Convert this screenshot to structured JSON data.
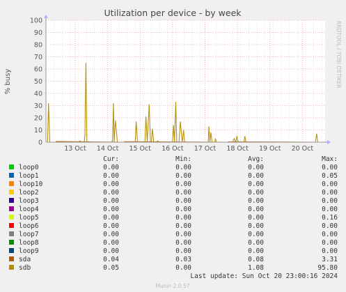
{
  "chart_data": {
    "type": "line",
    "title": "Utilization per device - by week",
    "ylabel": "% busy",
    "side_text": "RRDTOOL / TOBI OETIKER",
    "ylim": [
      0,
      100
    ],
    "yticks": [
      0,
      10,
      20,
      30,
      40,
      50,
      60,
      70,
      80,
      90,
      100
    ],
    "xlim_days": [
      0,
      8.6
    ],
    "xticks": [
      {
        "label": "13 Oct",
        "day": 0.9
      },
      {
        "label": "14 Oct",
        "day": 1.9
      },
      {
        "label": "15 Oct",
        "day": 2.9
      },
      {
        "label": "16 Oct",
        "day": 3.9
      },
      {
        "label": "17 Oct",
        "day": 4.9
      },
      {
        "label": "18 Oct",
        "day": 5.9
      },
      {
        "label": "19 Oct",
        "day": 6.9
      },
      {
        "label": "20 Oct",
        "day": 7.9
      }
    ],
    "series": [
      {
        "name": "sdb",
        "color": "#b8900a",
        "x": [
          0.0,
          0.05,
          0.08,
          0.12,
          0.2,
          1.0,
          1.05,
          1.08,
          1.11,
          1.18,
          1.2,
          1.23,
          1.26,
          1.3,
          2.0,
          2.05,
          2.08,
          2.1,
          2.14,
          2.2,
          2.75,
          2.78,
          2.82,
          2.86,
          3.05,
          3.08,
          3.12,
          3.18,
          3.22,
          3.25,
          3.28,
          3.32,
          3.37,
          3.4,
          3.44,
          3.5,
          3.85,
          3.9,
          3.93,
          3.96,
          4.0,
          4.03,
          4.06,
          4.1,
          4.14,
          4.2,
          4.24,
          4.27,
          4.3,
          4.33,
          4.38,
          4.45,
          4.95,
          5.0,
          5.02,
          5.05,
          5.08,
          5.12,
          5.2,
          5.22,
          5.25,
          5.3,
          5.75,
          5.8,
          5.85,
          5.88,
          5.92,
          6.1,
          6.13,
          6.16,
          6.2,
          8.3,
          8.34,
          8.37,
          8.4,
          8.5
        ],
        "values": [
          0,
          0,
          32,
          0,
          0,
          0,
          1,
          0,
          0,
          0,
          6,
          65,
          0,
          0,
          0,
          1,
          32,
          0,
          18,
          0,
          0,
          17,
          0,
          0,
          0,
          21,
          0,
          31,
          0,
          0,
          11,
          0,
          0,
          0,
          1,
          0,
          0,
          0,
          14,
          0,
          33,
          0,
          0,
          0,
          17,
          0,
          10,
          0,
          0,
          0,
          0,
          0,
          0,
          0,
          13,
          0,
          8,
          0,
          0,
          3,
          0,
          0,
          0,
          3,
          0,
          5,
          0,
          0,
          5,
          0,
          0,
          0,
          7,
          0,
          0,
          0
        ]
      },
      {
        "name": "sda",
        "color": "#b85c00",
        "x": [
          0.0,
          0.3,
          0.32,
          2.4,
          2.42,
          5.6,
          5.62,
          8.5
        ],
        "values": [
          0,
          0,
          0.5,
          0,
          0.4,
          0,
          0.3,
          0
        ]
      }
    ]
  },
  "legend": {
    "headers": {
      "cur": "Cur:",
      "min": "Min:",
      "avg": "Avg:",
      "max": "Max:"
    },
    "rows": [
      {
        "name": "loop0",
        "color": "#00cc00",
        "cur": "0.00",
        "min": "0.00",
        "avg": "0.00",
        "max": "0.00"
      },
      {
        "name": "loop1",
        "color": "#0066b3",
        "cur": "0.00",
        "min": "0.00",
        "avg": "0.00",
        "max": "0.05"
      },
      {
        "name": "loop10",
        "color": "#ff8000",
        "cur": "0.00",
        "min": "0.00",
        "avg": "0.00",
        "max": "0.00"
      },
      {
        "name": "loop2",
        "color": "#ffcc00",
        "cur": "0.00",
        "min": "0.00",
        "avg": "0.00",
        "max": "0.00"
      },
      {
        "name": "loop3",
        "color": "#330099",
        "cur": "0.00",
        "min": "0.00",
        "avg": "0.00",
        "max": "0.00"
      },
      {
        "name": "loop4",
        "color": "#990099",
        "cur": "0.00",
        "min": "0.00",
        "avg": "0.00",
        "max": "0.00"
      },
      {
        "name": "loop5",
        "color": "#ccff00",
        "cur": "0.00",
        "min": "0.00",
        "avg": "0.00",
        "max": "0.16"
      },
      {
        "name": "loop6",
        "color": "#ff0000",
        "cur": "0.00",
        "min": "0.00",
        "avg": "0.00",
        "max": "0.00"
      },
      {
        "name": "loop7",
        "color": "#808080",
        "cur": "0.00",
        "min": "0.00",
        "avg": "0.00",
        "max": "0.00"
      },
      {
        "name": "loop8",
        "color": "#008f00",
        "cur": "0.00",
        "min": "0.00",
        "avg": "0.00",
        "max": "0.00"
      },
      {
        "name": "loop9",
        "color": "#00487d",
        "cur": "0.00",
        "min": "0.00",
        "avg": "0.00",
        "max": "0.00"
      },
      {
        "name": "sda",
        "color": "#b35a00",
        "cur": "0.04",
        "min": "0.03",
        "avg": "0.08",
        "max": "3.31"
      },
      {
        "name": "sdb",
        "color": "#b38f00",
        "cur": "0.05",
        "min": "0.00",
        "avg": "1.08",
        "max": "95.80"
      }
    ]
  },
  "last_update": "Last update: Sun Oct 20 23:00:16 2024",
  "footer": "Munin 2.0.57"
}
